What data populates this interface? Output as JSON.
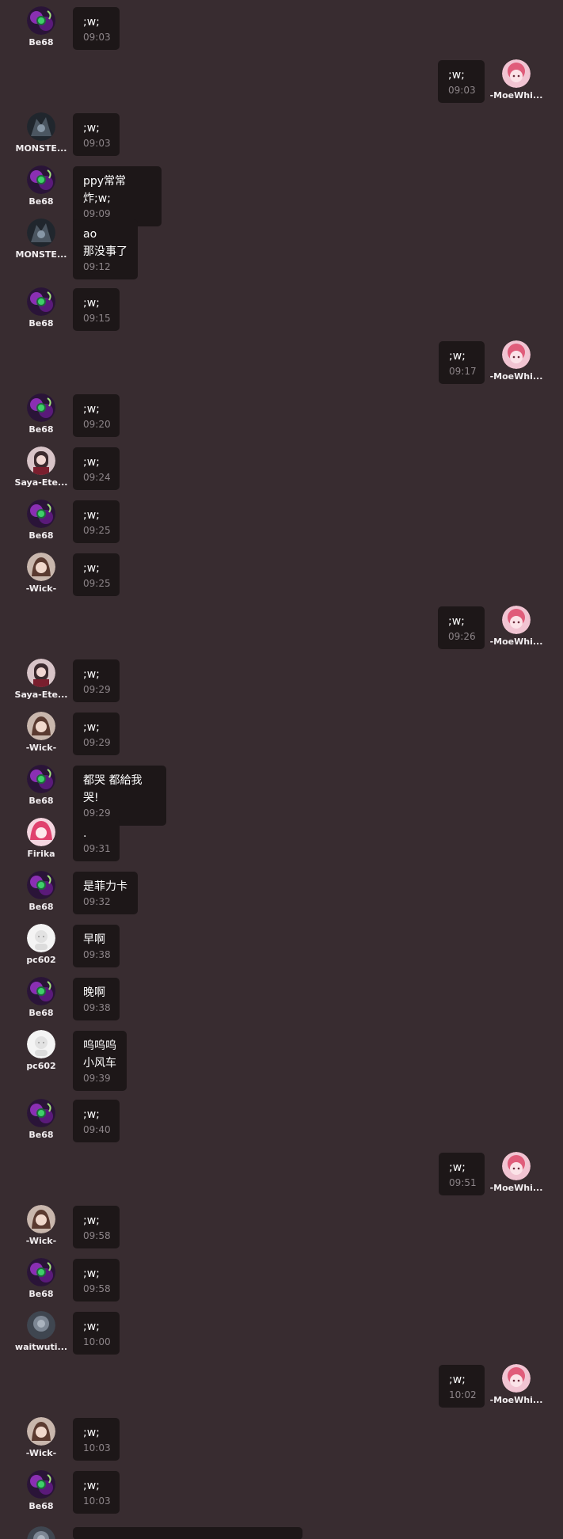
{
  "messages": [
    {
      "side": "left",
      "user": "Be68",
      "avatar": "be68",
      "text": ";w;",
      "time": "09:03"
    },
    {
      "side": "right",
      "user": "-MoeWhi...",
      "avatar": "moe",
      "text": ";w;",
      "time": "09:03"
    },
    {
      "side": "left",
      "user": "MONSTE...",
      "avatar": "monster",
      "text": ";w;",
      "time": "09:03"
    },
    {
      "side": "left",
      "user": "Be68",
      "avatar": "be68",
      "text": "ppy常常炸;w;",
      "time": "09:09"
    },
    {
      "side": "left",
      "user": "MONSTE...",
      "avatar": "monster",
      "text": "ao\n那没事了",
      "time": "09:12"
    },
    {
      "side": "left",
      "user": "Be68",
      "avatar": "be68",
      "text": ";w;",
      "time": "09:15"
    },
    {
      "side": "right",
      "user": "-MoeWhi...",
      "avatar": "moe",
      "text": ";w;",
      "time": "09:17"
    },
    {
      "side": "left",
      "user": "Be68",
      "avatar": "be68",
      "text": ";w;",
      "time": "09:20"
    },
    {
      "side": "left",
      "user": "Saya-Ete...",
      "avatar": "saya",
      "text": ";w;",
      "time": "09:24"
    },
    {
      "side": "left",
      "user": "Be68",
      "avatar": "be68",
      "text": ";w;",
      "time": "09:25"
    },
    {
      "side": "left",
      "user": "-Wick-",
      "avatar": "wick",
      "text": ";w;",
      "time": "09:25"
    },
    {
      "side": "right",
      "user": "-MoeWhi...",
      "avatar": "moe",
      "text": ";w;",
      "time": "09:26"
    },
    {
      "side": "left",
      "user": "Saya-Ete...",
      "avatar": "saya",
      "text": ";w;",
      "time": "09:29"
    },
    {
      "side": "left",
      "user": "-Wick-",
      "avatar": "wick",
      "text": ";w;",
      "time": "09:29"
    },
    {
      "side": "left",
      "user": "Be68",
      "avatar": "be68",
      "text": "都哭 都給我哭!",
      "time": "09:29"
    },
    {
      "side": "left",
      "user": "Firika",
      "avatar": "firika",
      "text": ".",
      "time": "09:31"
    },
    {
      "side": "left",
      "user": "Be68",
      "avatar": "be68",
      "text": "是菲力卡",
      "time": "09:32"
    },
    {
      "side": "left",
      "user": "pc602",
      "avatar": "pc602",
      "text": "早啊",
      "time": "09:38"
    },
    {
      "side": "left",
      "user": "Be68",
      "avatar": "be68",
      "text": "晚啊",
      "time": "09:38"
    },
    {
      "side": "left",
      "user": "pc602",
      "avatar": "pc602",
      "text": "呜呜呜\n小风车",
      "time": "09:39"
    },
    {
      "side": "left",
      "user": "Be68",
      "avatar": "be68",
      "text": ";w;",
      "time": "09:40"
    },
    {
      "side": "right",
      "user": "-MoeWhi...",
      "avatar": "moe",
      "text": ";w;",
      "time": "09:51"
    },
    {
      "side": "left",
      "user": "-Wick-",
      "avatar": "wick",
      "text": ";w;",
      "time": "09:58"
    },
    {
      "side": "left",
      "user": "Be68",
      "avatar": "be68",
      "text": ";w;",
      "time": "09:58"
    },
    {
      "side": "left",
      "user": "waitwuti...",
      "avatar": "wait",
      "text": ";w;",
      "time": "10:00"
    },
    {
      "side": "right",
      "user": "-MoeWhi...",
      "avatar": "moe",
      "text": ";w;",
      "time": "10:02"
    },
    {
      "side": "left",
      "user": "-Wick-",
      "avatar": "wick",
      "text": ";w;",
      "time": "10:03"
    },
    {
      "side": "left",
      "user": "Be68",
      "avatar": "be68",
      "text": ";w;",
      "time": "10:03"
    },
    {
      "side": "left",
      "user": "",
      "avatar": "wait",
      "text": "",
      "time": ""
    }
  ]
}
